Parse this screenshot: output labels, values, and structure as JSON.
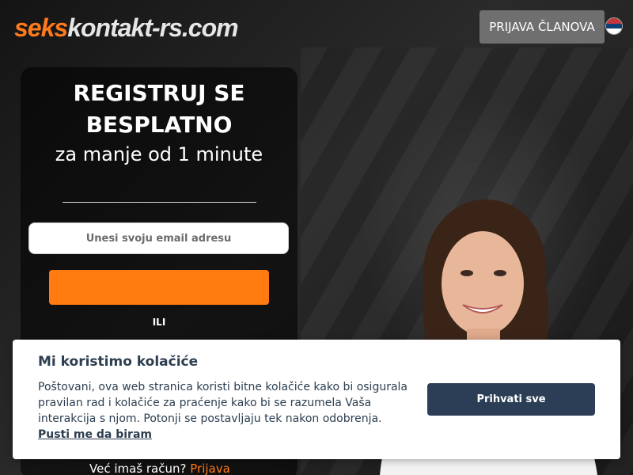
{
  "header": {
    "logo_part1": "seks",
    "logo_part2": "kontakt-rs.com",
    "login_label": "PRIJAVA ČLANOVA",
    "flag_icon": "serbia-flag-icon"
  },
  "register": {
    "title": "REGISTRUJ SE BESPLATNO",
    "subtitle": "za manje od 1 minute",
    "email_placeholder": "Unesi svoju email adresu",
    "submit_label": "",
    "or_label": "ILI",
    "has_account": "Već imaš račun?",
    "login_link": "Prijava"
  },
  "cookie_banner": {
    "title": "Mi koristimo kolačiće",
    "text": "Poštovani, ova web stranica koristi bitne kolačiće kako bi osigurala pravilan rad i kolačiće za praćenje kako bi se razumela Vaša interakcija s njom. Potonji se postavljaju tek nakon odobrenja.",
    "choose_link": "Pusti me da biram",
    "accept_label": "Prihvati sve"
  },
  "colors": {
    "accent": "#ff7a1a",
    "button_dark": "#2c3e56",
    "login_button": "#6f6f6f"
  }
}
